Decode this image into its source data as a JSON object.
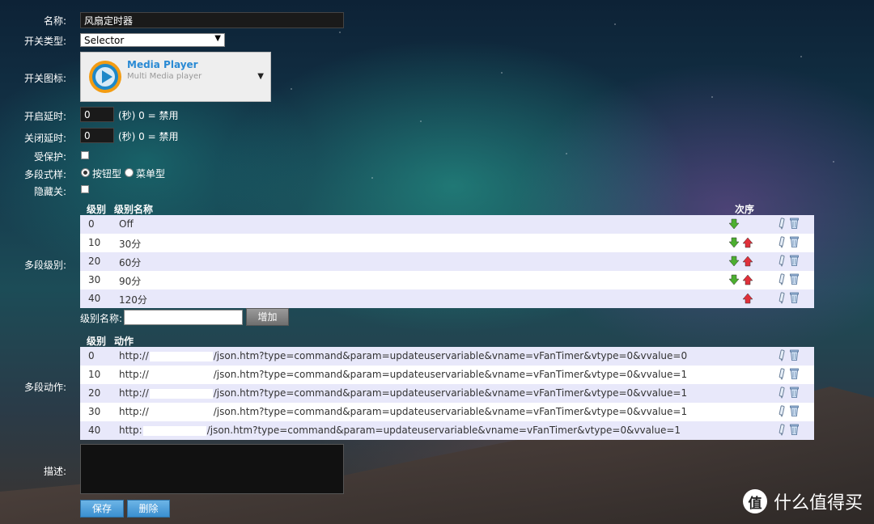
{
  "form": {
    "name": {
      "label": "名称:",
      "value": "风扇定时器"
    },
    "switch_type": {
      "label": "开关类型:",
      "value": "Selector"
    },
    "switch_icon": {
      "label": "开关图标:",
      "title": "Media Player",
      "subtitle": "Multi Media player"
    },
    "on_delay": {
      "label": "开启延时:",
      "value": "0",
      "unit": "(秒) 0 = 禁用"
    },
    "off_delay": {
      "label": "关闭延时:",
      "value": "0",
      "unit": "(秒) 0 = 禁用"
    },
    "protected": {
      "label": "受保护:"
    },
    "multi_style": {
      "label": "多段式样:",
      "option_button": "按钮型",
      "option_menu": "菜单型",
      "selected": "按钮型"
    },
    "hidden_off": {
      "label": "隐藏关:"
    },
    "levels_label": "多段级别:",
    "actions_label": "多段动作:",
    "description_label": "描述:"
  },
  "levels_table": {
    "headers": {
      "level": "级别",
      "name": "级别名称",
      "order": "次序"
    },
    "rows": [
      {
        "level": "0",
        "name": "Off"
      },
      {
        "level": "10",
        "name": "30分"
      },
      {
        "level": "20",
        "name": "60分"
      },
      {
        "level": "30",
        "name": "90分"
      },
      {
        "level": "40",
        "name": "120分"
      }
    ],
    "add_label": "级别名称:",
    "add_button": "增加"
  },
  "actions_table": {
    "headers": {
      "level": "级别",
      "action": "动作"
    },
    "rows": [
      {
        "level": "0",
        "prefix": "http://",
        "suffix": "/json.htm?type=command&param=updateuservariable&vname=vFanTimer&vtype=0&vvalue=0"
      },
      {
        "level": "10",
        "prefix": "http://",
        "suffix": "/json.htm?type=command&param=updateuservariable&vname=vFanTimer&vtype=0&vvalue=1"
      },
      {
        "level": "20",
        "prefix": "http://",
        "suffix": "/json.htm?type=command&param=updateuservariable&vname=vFanTimer&vtype=0&vvalue=1"
      },
      {
        "level": "30",
        "prefix": "http://",
        "suffix": "/json.htm?type=command&param=updateuservariable&vname=vFanTimer&vtype=0&vvalue=1"
      },
      {
        "level": "40",
        "prefix": "http:",
        "suffix": "/json.htm?type=command&param=updateuservariable&vname=vFanTimer&vtype=0&vvalue=1"
      }
    ]
  },
  "buttons": {
    "save": "保存",
    "delete": "删除"
  },
  "watermark": {
    "logo": "值",
    "text": "什么值得买"
  },
  "colors": {
    "row_odd": "#e8e8fa",
    "row_even": "#ffffff",
    "arrow_down": "#4caf30",
    "arrow_up": "#e0303a",
    "title_blue": "#2a8ad4"
  }
}
